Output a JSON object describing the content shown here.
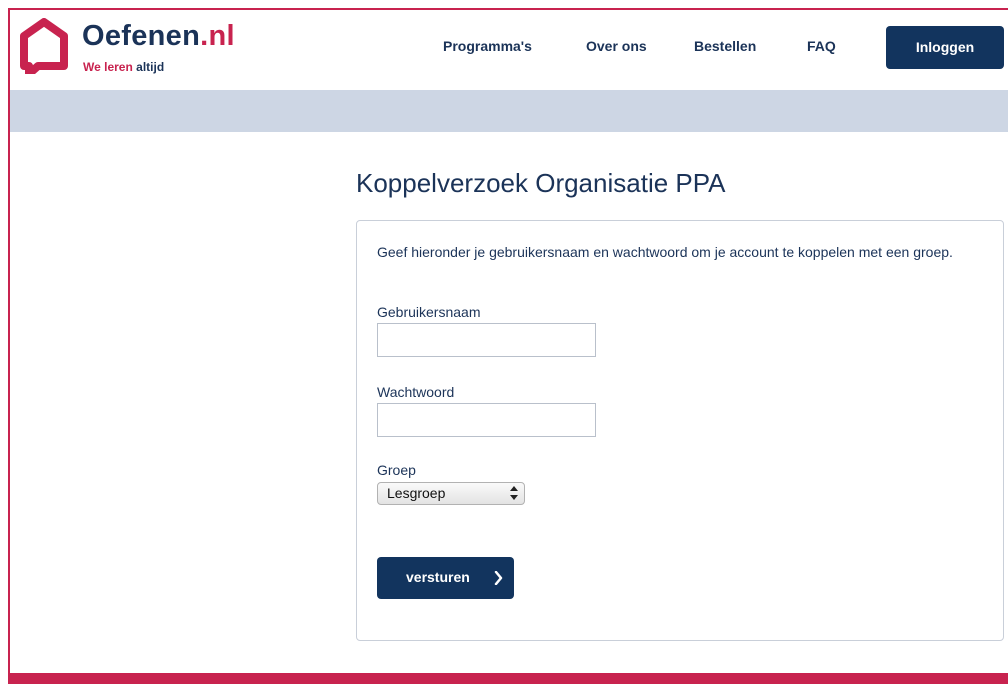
{
  "header": {
    "brand": {
      "name": "Oefenen",
      "tld": ".nl",
      "tagline_red": "We leren",
      "tagline_rest": " altijd"
    },
    "nav": [
      "Programma's",
      "Over ons",
      "Bestellen",
      "FAQ"
    ],
    "login_label": "Inloggen"
  },
  "page": {
    "title": "Koppelverzoek Organisatie PPA"
  },
  "form": {
    "intro": "Geef hieronder je gebruikersnaam en wachtwoord om je account te koppelen met een groep.",
    "username_label": "Gebruikersnaam",
    "username_value": "",
    "password_label": "Wachtwoord",
    "password_value": "",
    "group_label": "Groep",
    "group_selected": "Lesgroep",
    "submit_label": "versturen"
  },
  "colors": {
    "brand_blue": "#12345e",
    "brand_red": "#c8234f",
    "band": "#cdd6e4"
  },
  "icons": [
    "house-logo-icon",
    "select-arrows-icon",
    "chevron-right-icon"
  ]
}
